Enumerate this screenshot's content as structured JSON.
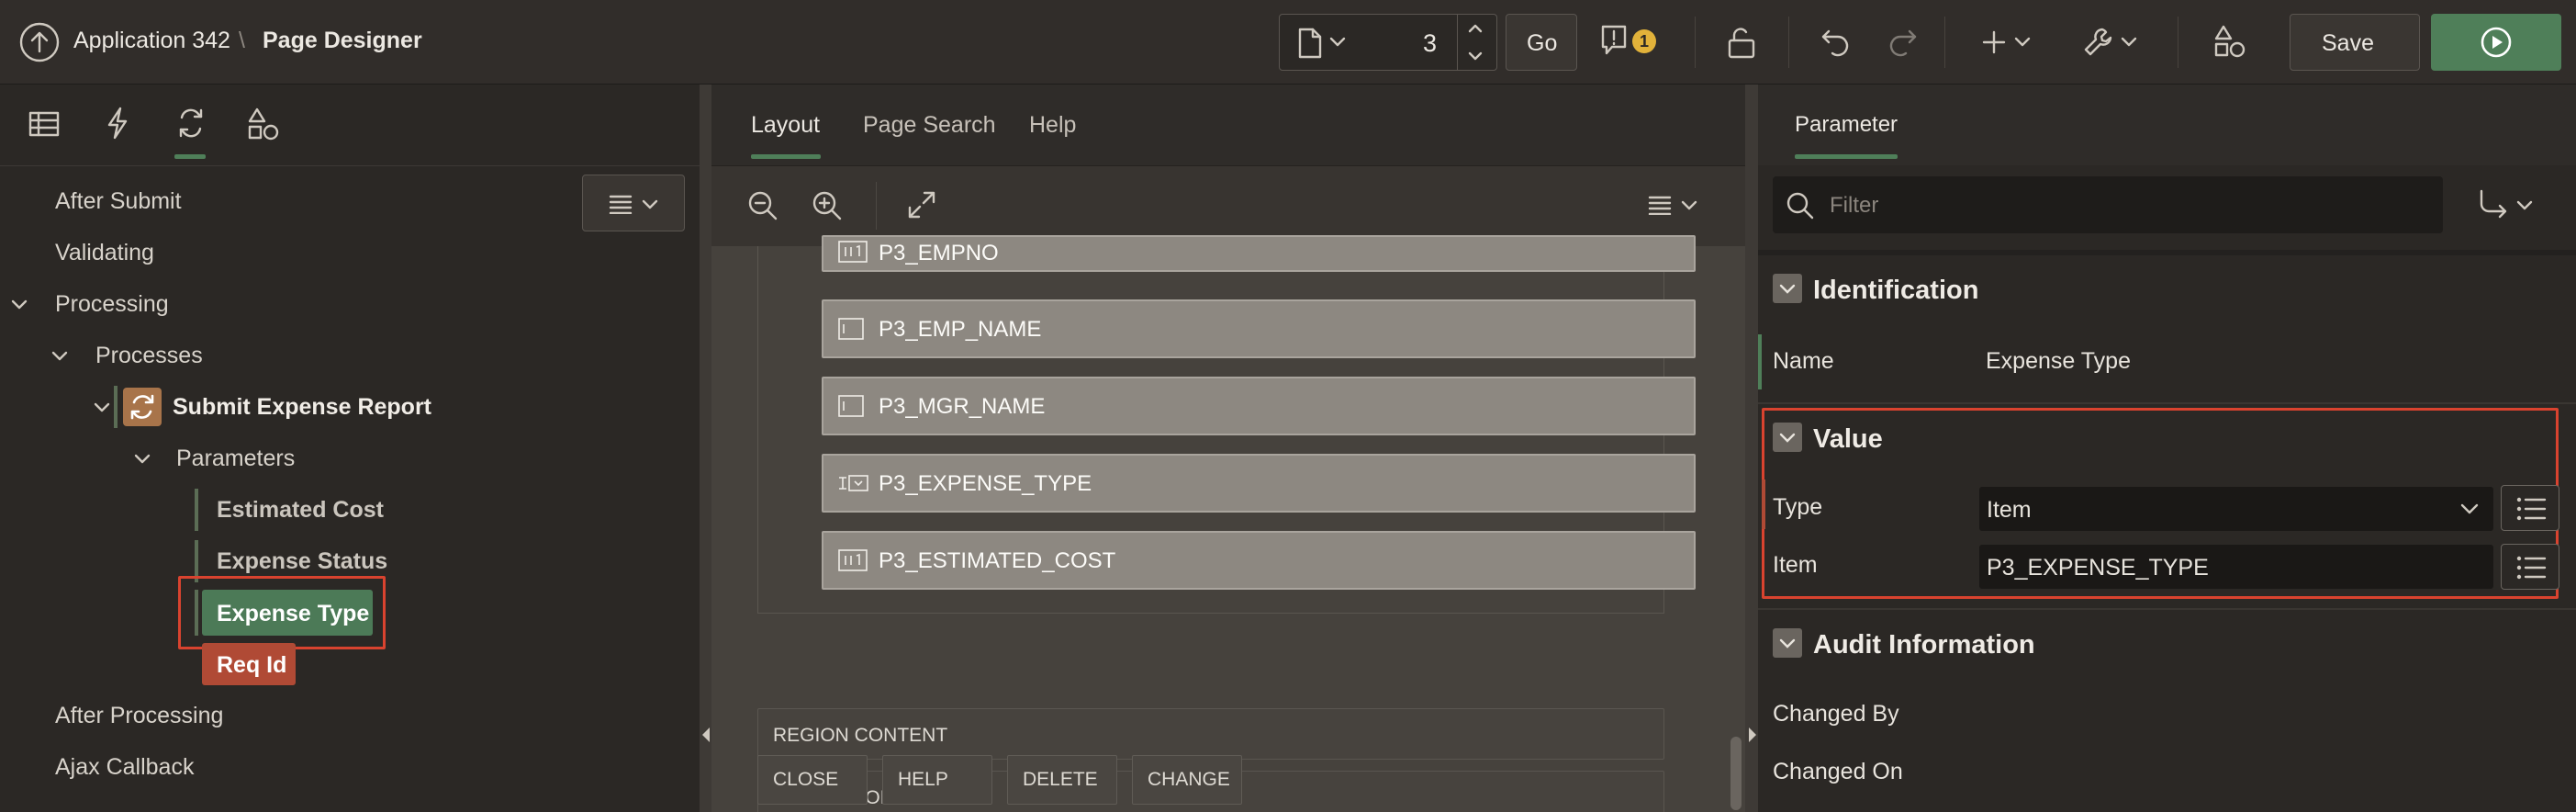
{
  "header": {
    "app_name": "Application 342",
    "separator": "\\",
    "page_designer": "Page Designer",
    "page_number": "3",
    "go_label": "Go",
    "warning_count": "1",
    "save_label": "Save"
  },
  "left": {
    "tree": {
      "after_submit": "After Submit",
      "validating": "Validating",
      "processing": "Processing",
      "processes": "Processes",
      "submit_expense_report": "Submit Expense Report",
      "parameters": "Parameters",
      "estimated_cost": "Estimated Cost",
      "expense_status": "Expense Status",
      "expense_type": "Expense Type",
      "req_id": "Req Id",
      "after_processing": "After Processing",
      "ajax_callback": "Ajax Callback"
    }
  },
  "middle": {
    "tabs": [
      "Layout",
      "Page Search",
      "Help"
    ],
    "fields": [
      "P3_EMPNO",
      "P3_EMP_NAME",
      "P3_MGR_NAME",
      "P3_EXPENSE_TYPE",
      "P3_ESTIMATED_COST"
    ],
    "region_content": "REGION CONTENT",
    "sub_regions": "SUB REGIONS",
    "buttons": [
      "CLOSE",
      "HELP",
      "DELETE",
      "CHANGE"
    ]
  },
  "right": {
    "tab": "Parameter",
    "filter_placeholder": "Filter",
    "identification": {
      "title": "Identification",
      "name_label": "Name",
      "name_value": "Expense Type"
    },
    "value": {
      "title": "Value",
      "type_label": "Type",
      "type_value": "Item",
      "item_label": "Item",
      "item_value": "P3_EXPENSE_TYPE"
    },
    "audit": {
      "title": "Audit Information",
      "changed_by": "Changed By",
      "changed_on": "Changed On"
    }
  },
  "colors": {
    "accent_green": "#4f7f59",
    "selected_node": "#4c7a57",
    "error_node": "#b04a35",
    "highlight_red": "#d9432f",
    "warning_badge": "#e2b23a"
  }
}
